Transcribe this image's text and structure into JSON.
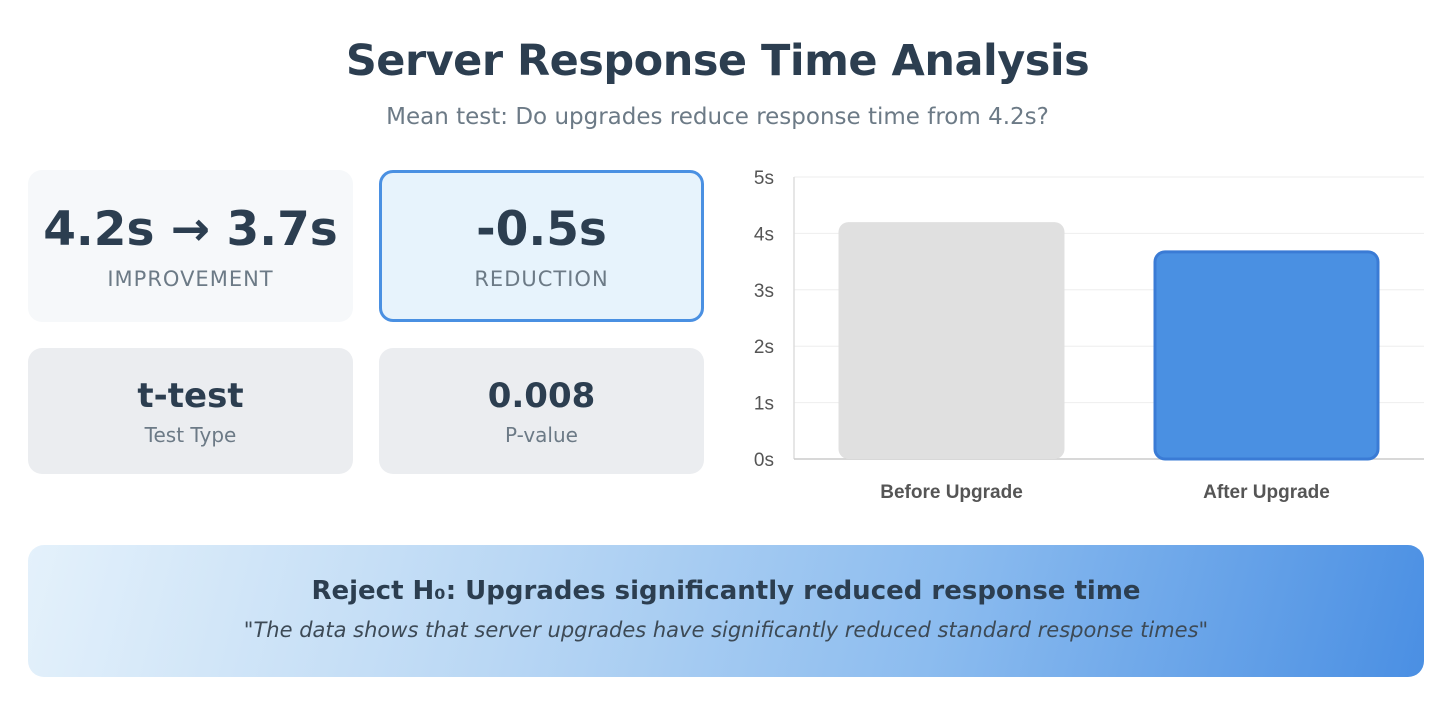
{
  "header": {
    "title": "Server Response Time Analysis",
    "subtitle": "Mean test: Do upgrades reduce response time from 4.2s?"
  },
  "stats": [
    {
      "value": "4.2s → 3.7s",
      "label": "IMPROVEMENT"
    },
    {
      "value": "-0.5s",
      "label": "REDUCTION"
    },
    {
      "value": "t-test",
      "label": "Test Type"
    },
    {
      "value": "0.008",
      "label": "P-value"
    }
  ],
  "conclusion": {
    "title": "Reject H₀: Upgrades significantly reduced response time",
    "quote": "\"The data shows that server upgrades have significantly reduced standard response times\""
  },
  "colors": {
    "before_bar": "#e0e0e0",
    "after_bar": "#4a90e2",
    "after_bar_border": "#3a7bd5",
    "accent": "#4a90e2"
  },
  "chart_data": {
    "type": "bar",
    "categories": [
      "Before Upgrade",
      "After Upgrade"
    ],
    "values": [
      4.2,
      3.7
    ],
    "ylim": [
      0,
      5
    ],
    "yticks": [
      0,
      1,
      2,
      3,
      4,
      5
    ],
    "ytick_labels": [
      "0s",
      "1s",
      "2s",
      "3s",
      "4s",
      "5s"
    ],
    "grid": true,
    "legend": "none",
    "title": "",
    "xlabel": "",
    "ylabel": ""
  }
}
